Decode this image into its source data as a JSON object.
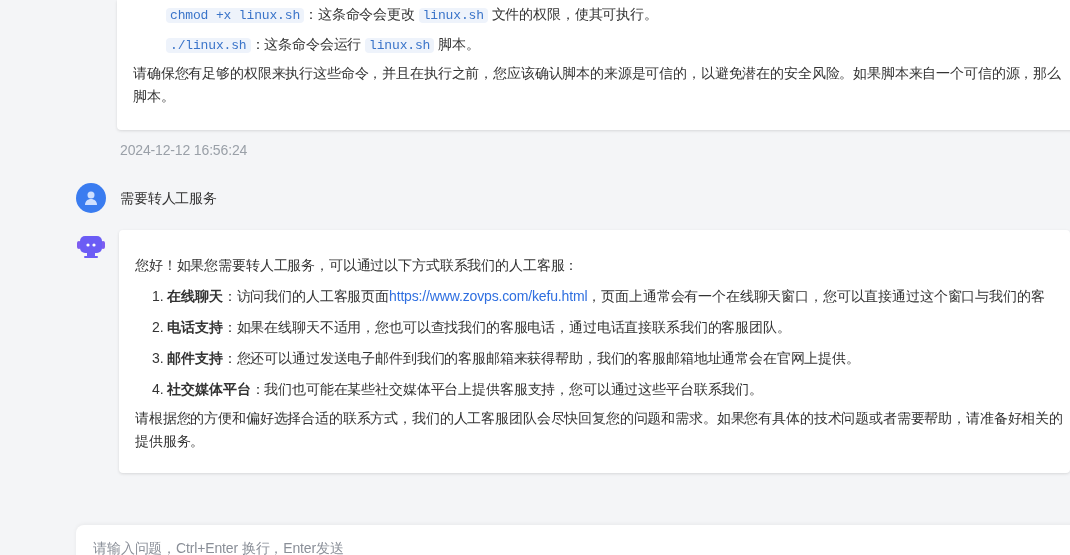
{
  "previous_reply": {
    "commands": [
      {
        "segments": [
          {
            "kind": "code",
            "text": "chmod +x linux.sh"
          },
          {
            "kind": "text",
            "text": "：这条命令会更改 "
          },
          {
            "kind": "code",
            "text": "linux.sh"
          },
          {
            "kind": "text",
            "text": " 文件的权限，使其可执行。"
          }
        ]
      },
      {
        "segments": [
          {
            "kind": "code",
            "text": "./linux.sh"
          },
          {
            "kind": "text",
            "text": "：这条命令会运行 "
          },
          {
            "kind": "code",
            "text": "linux.sh"
          },
          {
            "kind": "text",
            "text": " 脚本。"
          }
        ]
      }
    ],
    "paragraph_lines": [
      "请确保您有足够的权限来执行这些命令，并且在执行之前，您应该确认脚本的来源是可信的，以避免潜在的安全风险。如果脚本来自一个可信的源，那么",
      "脚本。"
    ]
  },
  "timestamp": "2024-12-12 16:56:24",
  "user_message": {
    "text": "需要转人工服务"
  },
  "bot_reply": {
    "intro": "您好！如果您需要转人工服务，可以通过以下方式联系我们的人工客服：",
    "items": [
      {
        "number": "1.",
        "segments": [
          {
            "kind": "text",
            "text": "**在线聊天**：访问我们的人工客服页面 "
          },
          {
            "kind": "link",
            "text": "https://www.zovps.com/kefu.html"
          },
          {
            "kind": "text",
            "text": "，页面上通常会有一个在线聊天窗口，您可以直接通过这个窗口与我们的客"
          }
        ]
      },
      {
        "number": "2.",
        "segments": [
          {
            "kind": "text",
            "text": "**电话支持**：如果在线聊天不适用，您也可以查找我们的客服电话，通过电话直接联系我们的客服团队。"
          }
        ]
      },
      {
        "number": "3.",
        "segments": [
          {
            "kind": "text",
            "text": "**邮件支持**：您还可以通过发送电子邮件到我们的客服邮箱来获得帮助，我们的客服邮箱地址通常会在官网上提供。"
          }
        ]
      },
      {
        "number": "4.",
        "segments": [
          {
            "kind": "text",
            "text": "**社交媒体平台**：我们也可能在某些社交媒体平台上提供客服支持，您可以通过这些平台联系我们。"
          }
        ]
      }
    ],
    "closing_lines": [
      "请根据您的方便和偏好选择合适的联系方式，我们的人工客服团队会尽快回复您的问题和需求。如果您有具体的技术问题或者需要帮助，请准备好相关的",
      "提供服务。"
    ]
  },
  "input": {
    "placeholder": "请输入问题，Ctrl+Enter 换行，Enter发送"
  }
}
